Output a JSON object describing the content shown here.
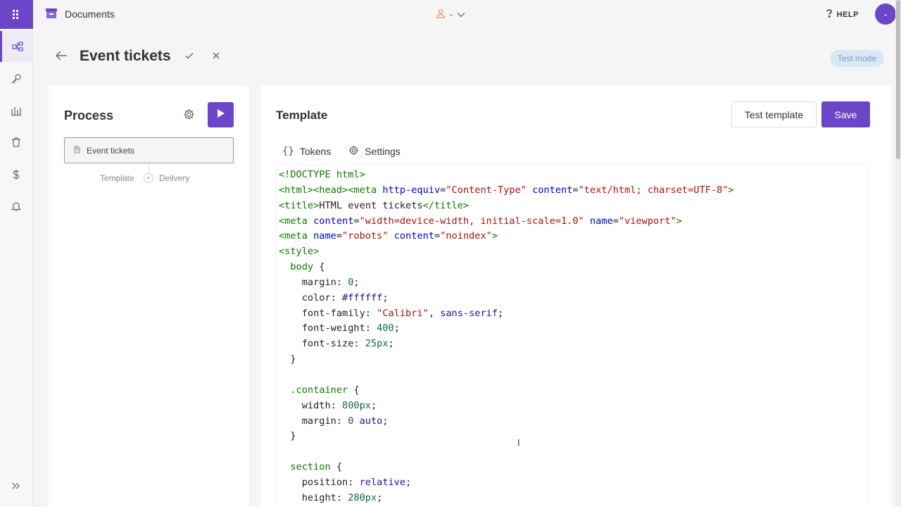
{
  "app": {
    "name": "Documents"
  },
  "user": {
    "name": "-"
  },
  "help": {
    "label": "HELP"
  },
  "avatar": {
    "initial": "-"
  },
  "page": {
    "title": "Event tickets",
    "mode_badge": "Test mode"
  },
  "process": {
    "title": "Process",
    "step_label": "Event tickets",
    "sub_left": "Template",
    "sub_right": "Delivery"
  },
  "template": {
    "title": "Template",
    "test_button": "Test template",
    "save_button": "Save",
    "tabs": [
      {
        "label": "Tokens"
      },
      {
        "label": "Settings"
      }
    ]
  },
  "code_lines": [
    [
      [
        "tag",
        "<!DOCTYPE html>"
      ]
    ],
    [
      [
        "tag",
        "<html><head><meta "
      ],
      [
        "attr",
        "http-equiv"
      ],
      [
        "txt",
        "="
      ],
      [
        "str",
        "\"Content-Type\""
      ],
      [
        "txt",
        " "
      ],
      [
        "attr",
        "content"
      ],
      [
        "txt",
        "="
      ],
      [
        "str",
        "\"text/html; charset=UTF-8\""
      ],
      [
        "tag",
        ">"
      ]
    ],
    [
      [
        "tag",
        "<title>"
      ],
      [
        "txt",
        "HTML event tickets"
      ],
      [
        "tag",
        "</title>"
      ]
    ],
    [
      [
        "tag",
        "<meta "
      ],
      [
        "attr",
        "content"
      ],
      [
        "txt",
        "="
      ],
      [
        "str",
        "\"width=device-width, initial-scale=1.0\""
      ],
      [
        "txt",
        " "
      ],
      [
        "attr",
        "name"
      ],
      [
        "txt",
        "="
      ],
      [
        "str",
        "\"viewport\""
      ],
      [
        "tag",
        ">"
      ]
    ],
    [
      [
        "tag",
        "<meta "
      ],
      [
        "attr",
        "name"
      ],
      [
        "txt",
        "="
      ],
      [
        "str",
        "\"robots\""
      ],
      [
        "txt",
        " "
      ],
      [
        "attr",
        "content"
      ],
      [
        "txt",
        "="
      ],
      [
        "str",
        "\"noindex\""
      ],
      [
        "tag",
        ">"
      ]
    ],
    [
      [
        "tag",
        "<style>"
      ]
    ],
    [
      [
        "txt",
        "  "
      ],
      [
        "sel",
        "body"
      ],
      [
        "txt",
        " {"
      ]
    ],
    [
      [
        "prop",
        "    margin: "
      ],
      [
        "num",
        "0"
      ],
      [
        "txt",
        ";"
      ]
    ],
    [
      [
        "prop",
        "    color: "
      ],
      [
        "kw",
        "#ffffff"
      ],
      [
        "txt",
        ";"
      ]
    ],
    [
      [
        "prop",
        "    font-family: "
      ],
      [
        "str",
        "\"Calibri\""
      ],
      [
        "txt",
        ", "
      ],
      [
        "kw",
        "sans-serif"
      ],
      [
        "txt",
        ";"
      ]
    ],
    [
      [
        "prop",
        "    font-weight: "
      ],
      [
        "num",
        "400"
      ],
      [
        "txt",
        ";"
      ]
    ],
    [
      [
        "prop",
        "    font-size: "
      ],
      [
        "num",
        "25px"
      ],
      [
        "txt",
        ";"
      ]
    ],
    [
      [
        "txt",
        "  }"
      ]
    ],
    [
      [
        "txt",
        ""
      ]
    ],
    [
      [
        "txt",
        "  "
      ],
      [
        "sel",
        ".container"
      ],
      [
        "txt",
        " {"
      ]
    ],
    [
      [
        "prop",
        "    width: "
      ],
      [
        "num",
        "800px"
      ],
      [
        "txt",
        ";"
      ]
    ],
    [
      [
        "prop",
        "    margin: "
      ],
      [
        "num",
        "0"
      ],
      [
        "txt",
        " "
      ],
      [
        "kw",
        "auto"
      ],
      [
        "txt",
        ";"
      ]
    ],
    [
      [
        "txt",
        "  }"
      ]
    ],
    [
      [
        "txt",
        ""
      ]
    ],
    [
      [
        "txt",
        "  "
      ],
      [
        "sel",
        "section"
      ],
      [
        "txt",
        " {"
      ]
    ],
    [
      [
        "prop",
        "    position: "
      ],
      [
        "kw",
        "relative"
      ],
      [
        "txt",
        ";"
      ]
    ],
    [
      [
        "prop",
        "    height: "
      ],
      [
        "num",
        "280px"
      ],
      [
        "txt",
        ";"
      ]
    ]
  ],
  "colors": {
    "accent": "#6c46c8",
    "badge_bg": "#dbe8f3",
    "badge_text": "#6f9fc4"
  },
  "icons": [
    "apps-grid-icon",
    "flow-icon",
    "key-icon",
    "bar-chart-icon",
    "trash-icon",
    "dollar-icon",
    "bell-icon",
    "expand-icon",
    "documents-icon",
    "user-icon",
    "chevron-down-icon",
    "help-icon",
    "back-arrow-icon",
    "check-icon",
    "close-icon",
    "gear-icon",
    "play-icon",
    "file-icon",
    "braces-icon"
  ]
}
